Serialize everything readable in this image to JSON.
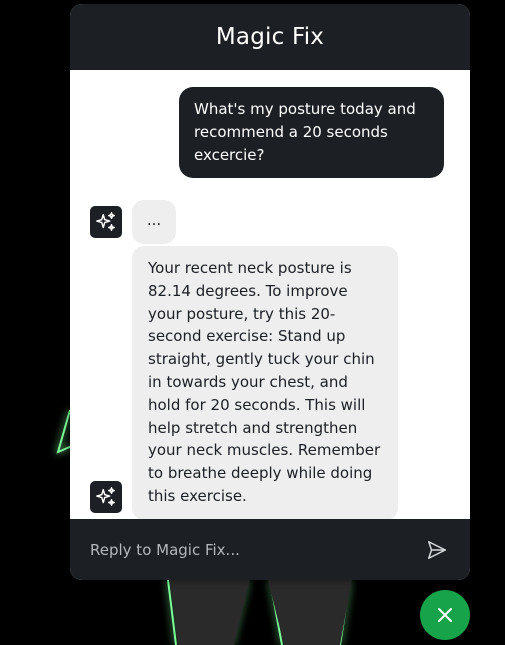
{
  "chat": {
    "title": "Magic Fix",
    "user_message": "What's my posture today and recommend a 20 seconds excercie?",
    "typing_indicator": "...",
    "bot_message": "Your recent neck posture is 82.14 degrees. To improve your posture, try this 20-second exercise: Stand up straight, gently tuck your chin in towards your chest, and hold for 20 seconds. This will help stretch and strengthen your neck muscles. Remember to breathe deeply while doing this exercise.",
    "input_placeholder": "Reply to Magic Fix..."
  },
  "icons": {
    "bot_avatar": "sparkles-icon",
    "send": "send-icon",
    "close": "close-icon"
  },
  "colors": {
    "header": "#1c1f24",
    "user_bubble": "#1c1f24",
    "bot_bubble": "#eeeeef",
    "fab": "#16a34a",
    "glow": "#39ff6a"
  }
}
